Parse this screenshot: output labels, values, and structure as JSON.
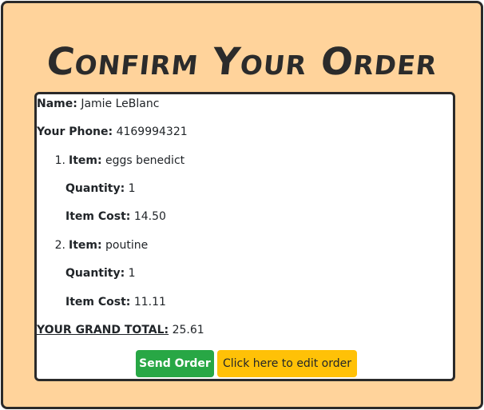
{
  "page": {
    "title": "Confirm Your Order"
  },
  "customer": {
    "name_label": "Name:",
    "name_value": "Jamie LeBlanc",
    "phone_label": "Your Phone:",
    "phone_value": "4169994321"
  },
  "items": [
    {
      "number": "1.",
      "item_label": "Item:",
      "item_value": "eggs benedict",
      "quantity_label": "Quantity:",
      "quantity_value": "1",
      "cost_label": "Item Cost:",
      "cost_value": "14.50"
    },
    {
      "number": "2.",
      "item_label": "Item:",
      "item_value": "poutine",
      "quantity_label": "Quantity:",
      "quantity_value": "1",
      "cost_label": "Item Cost:",
      "cost_value": "11.11"
    }
  ],
  "total": {
    "label": "YOUR GRAND TOTAL:",
    "value": "25.61"
  },
  "actions": {
    "send_label": "Send Order",
    "edit_label": "Click here to edit order"
  },
  "colors": {
    "background": "#ffd39b",
    "send_button": "#28a745",
    "edit_button": "#ffc107"
  }
}
